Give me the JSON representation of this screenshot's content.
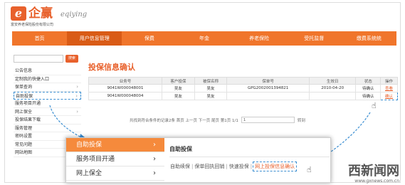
{
  "brand": {
    "logo_letter": "e",
    "name_cn": "企赢",
    "name_en": "eqiying",
    "subtitle": "富安养老保险股份有限公司",
    "accent": "#e8612c"
  },
  "nav": {
    "items": [
      "首页",
      "用户信息管理",
      "保费",
      "年金",
      "养老保险",
      "受托监督",
      "缴费系统统"
    ],
    "active_index": 1
  },
  "search": {
    "button_label": "搜索"
  },
  "sidebar": {
    "items": [
      {
        "label": "公告信息"
      },
      {
        "label": "定制我的快捷入口"
      },
      {
        "label": "保单查询"
      },
      {
        "label": "自助投保"
      },
      {
        "label": "服务项目开通"
      },
      {
        "label": "网上保全"
      },
      {
        "label": "投保结果下载"
      },
      {
        "label": "服务管理"
      },
      {
        "label": "密码设置"
      },
      {
        "label": "常见问题"
      },
      {
        "label": "网站地图"
      }
    ]
  },
  "main": {
    "title": "投保信息确认",
    "columns": [
      "业务号",
      "客户投保",
      "被保名称",
      "保单号",
      "生效日",
      "状态",
      "操作"
    ],
    "rows": [
      {
        "biz_no": "9041W000048001",
        "applicant": "吴友",
        "insured": "吴友",
        "policy_no": "GPG2002001394821",
        "date": "2010-04-20",
        "status": "待确认",
        "action": "查看"
      },
      {
        "biz_no": "9041W000048004",
        "applicant": "吴友",
        "insured": "吴友",
        "policy_no": "",
        "date": "",
        "status": "待确认",
        "action": "确认"
      }
    ],
    "pager_text": "共找到符合条件的记录2条 首页 上一页 下一页 尾页 第1页 1/1",
    "pager_input": "1",
    "pager_go": "转到"
  },
  "zoom": {
    "menu": [
      {
        "label": "自助投保",
        "active": true
      },
      {
        "label": "服务项目开通",
        "active": false
      },
      {
        "label": "网上保全",
        "active": false
      }
    ],
    "panel_title": "自助投保",
    "links": [
      "自助续保",
      "保单回执回销",
      "快速投保",
      "网上投保信息确认"
    ]
  },
  "watermark": {
    "text_cn": "西新闻网",
    "url": "www.gxnews.com.cn"
  }
}
